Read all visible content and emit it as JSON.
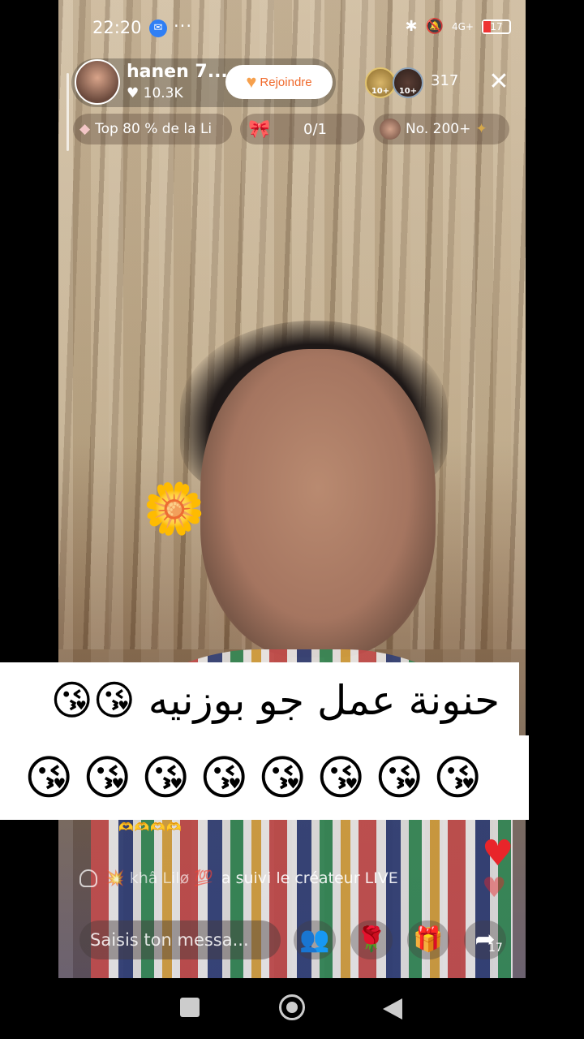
{
  "status_bar": {
    "time": "22:20",
    "dots": "···",
    "network": "4G+",
    "battery": "17",
    "icons": [
      "messenger-icon",
      "bluetooth-icon",
      "mute-icon",
      "signal-icon",
      "battery-icon"
    ]
  },
  "host": {
    "name": "hanen 7...",
    "likes": "♥ 10.3K",
    "join_label": "Rejoindre"
  },
  "viewers": {
    "badge1": "10+",
    "badge2": "10+",
    "count": "317"
  },
  "chips": {
    "rank_label": "Top 80 % de la Li",
    "goal_value": "0/1",
    "position_label": "No. 200+"
  },
  "caption": {
    "line1": "حنونة عمل جو بوزنيه 😘😘",
    "emojis": [
      "😘",
      "😘",
      "😘",
      "😘",
      "😘",
      "😘",
      "😘",
      "😘"
    ]
  },
  "feed": {
    "mini_hearts": "🫶🫶🫶🫶",
    "user": "💥 khâ Lilø 💯",
    "action": "a suivi le créateur LIVE"
  },
  "composer": {
    "placeholder": "Saisis ton messa...",
    "share_count": "17"
  },
  "colors": {
    "join_text": "#f06a2c",
    "heart": "#e8252a",
    "caption_bg": "#ffffff"
  }
}
